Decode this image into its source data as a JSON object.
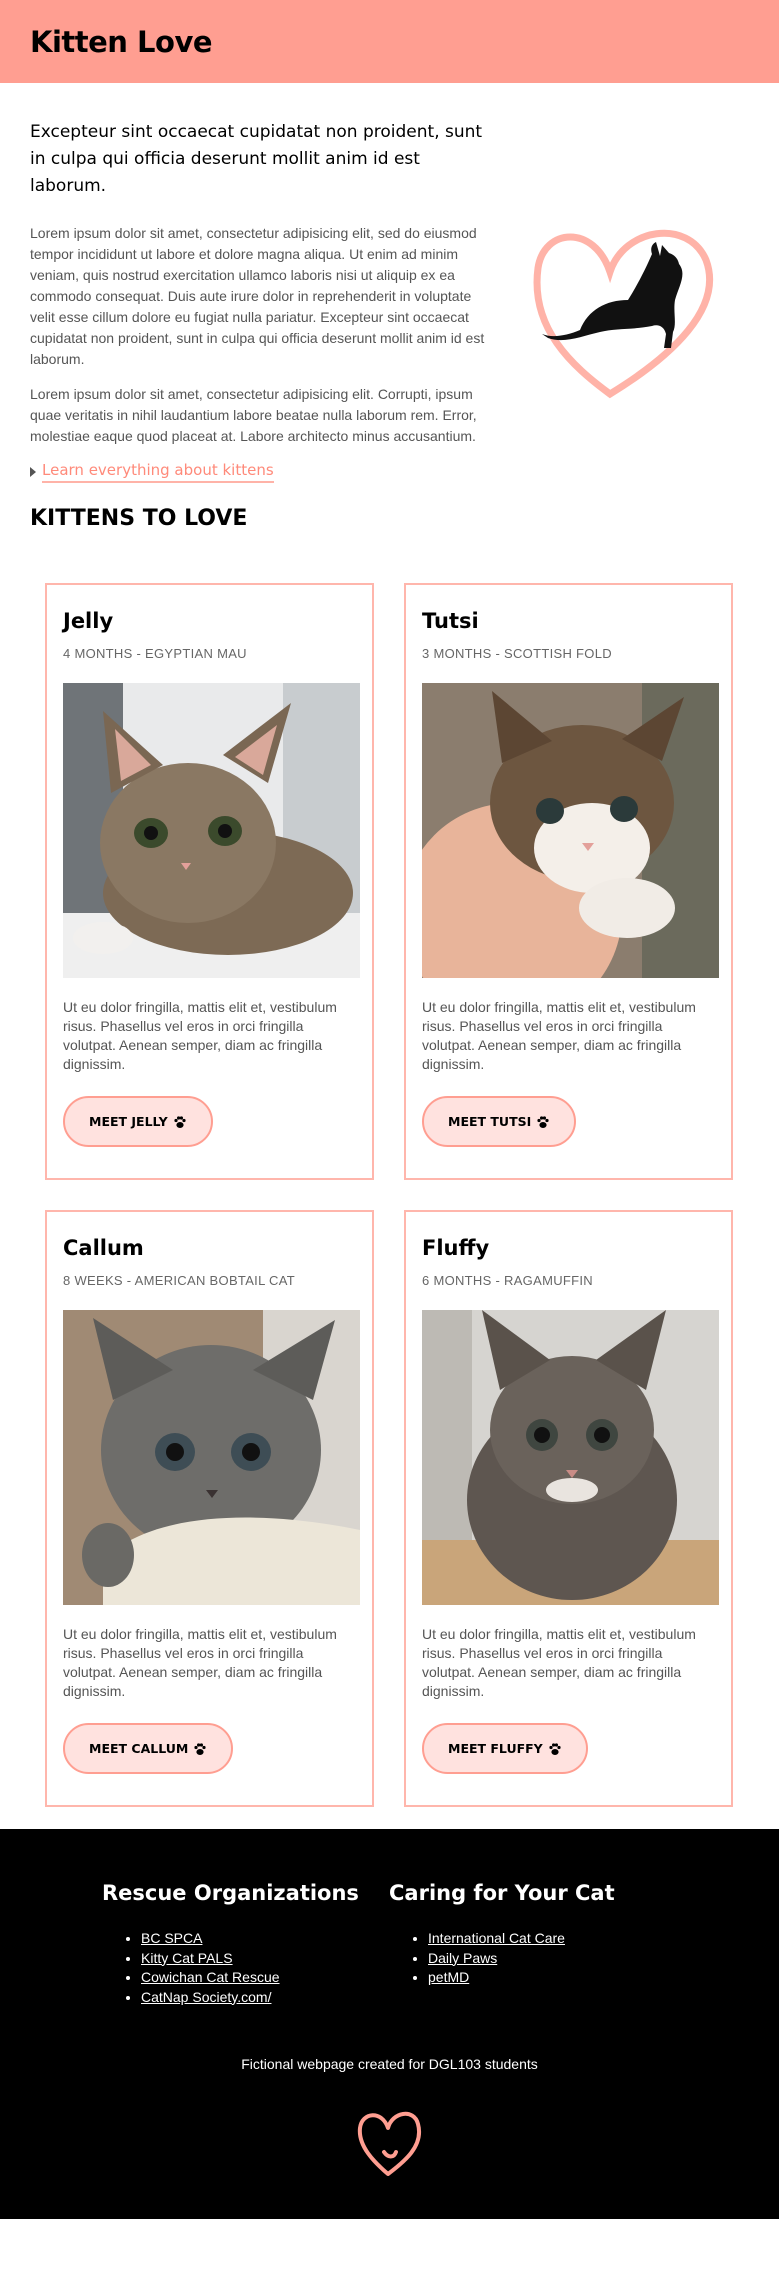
{
  "header": {
    "title": "Kitten Love"
  },
  "intro": {
    "lead": "Excepteur sint occaecat cupidatat non proident, sunt in culpa qui officia deserunt mollit anim id est laborum.",
    "paragraph1": "Lorem ipsum dolor sit amet, consectetur adipisicing elit, sed do eiusmod tempor incididunt ut labore et dolore magna aliqua. Ut enim ad minim veniam, quis nostrud exercitation ullamco laboris nisi ut aliquip ex ea commodo consequat. Duis aute irure dolor in reprehenderit in voluptate velit esse cillum dolore eu fugiat nulla pariatur. Excepteur sint occaecat cupidatat non proident, sunt in culpa qui officia deserunt mollit anim id est laborum.",
    "paragraph2": "Lorem ipsum dolor sit amet, consectetur adipisicing elit. Corrupti, ipsum quae veritatis in nihil laudantium labore beatae nulla laborum rem. Error, molestiae eaque quod placeat at. Labore architecto minus accusantium.",
    "link_label": "Learn everything about kittens"
  },
  "kittens_section": {
    "title": "KITTENS TO LOVE",
    "cards": [
      {
        "name": "Jelly",
        "meta": "4 MONTHS - EGYPTIAN MAU",
        "text": "Ut eu dolor fringilla, mattis elit et, vestibulum risus. Phasellus vel eros in orci fringilla volutpat. Aenean semper, diam ac fringilla dignissim.",
        "button": "MEET JELLY"
      },
      {
        "name": "Tutsi",
        "meta": "3 MONTHS - SCOTTISH FOLD",
        "text": "Ut eu dolor fringilla, mattis elit et, vestibulum risus. Phasellus vel eros in orci fringilla volutpat. Aenean semper, diam ac fringilla dignissim.",
        "button": "MEET TUTSI"
      },
      {
        "name": "Callum",
        "meta": "8 WEEKS - AMERICAN BOBTAIL CAT",
        "text": "Ut eu dolor fringilla, mattis elit et, vestibulum risus. Phasellus vel eros in orci fringilla volutpat. Aenean semper, diam ac fringilla dignissim.",
        "button": "MEET CALLUM"
      },
      {
        "name": "Fluffy",
        "meta": "6 MONTHS - RAGAMUFFIN",
        "text": "Ut eu dolor fringilla, mattis elit et, vestibulum risus. Phasellus vel eros in orci fringilla volutpat. Aenean semper, diam ac fringilla dignissim.",
        "button": "MEET FLUFFY"
      }
    ]
  },
  "footer": {
    "col1": {
      "title": "Rescue Organizations",
      "links": [
        "BC SPCA",
        "Kitty Cat PALS",
        "Cowichan Cat Rescue",
        "CatNap Society.com/"
      ]
    },
    "col2": {
      "title": "Caring for Your Cat",
      "links": [
        "International Cat Care",
        "Daily Paws",
        "petMD"
      ]
    },
    "note": "Fictional webpage created for DGL103 students"
  },
  "colors": {
    "accent": "#ff9e91",
    "card_border": "#ffb6ac",
    "button_fill": "#ffe2df",
    "link": "#ff8a7a",
    "footer_bg": "#000000"
  },
  "icons": {
    "paw": "paw-icon",
    "heart_cat": "heart-cat-illustration",
    "footer_heart": "heart-icon",
    "caret": "caret-right-icon"
  }
}
